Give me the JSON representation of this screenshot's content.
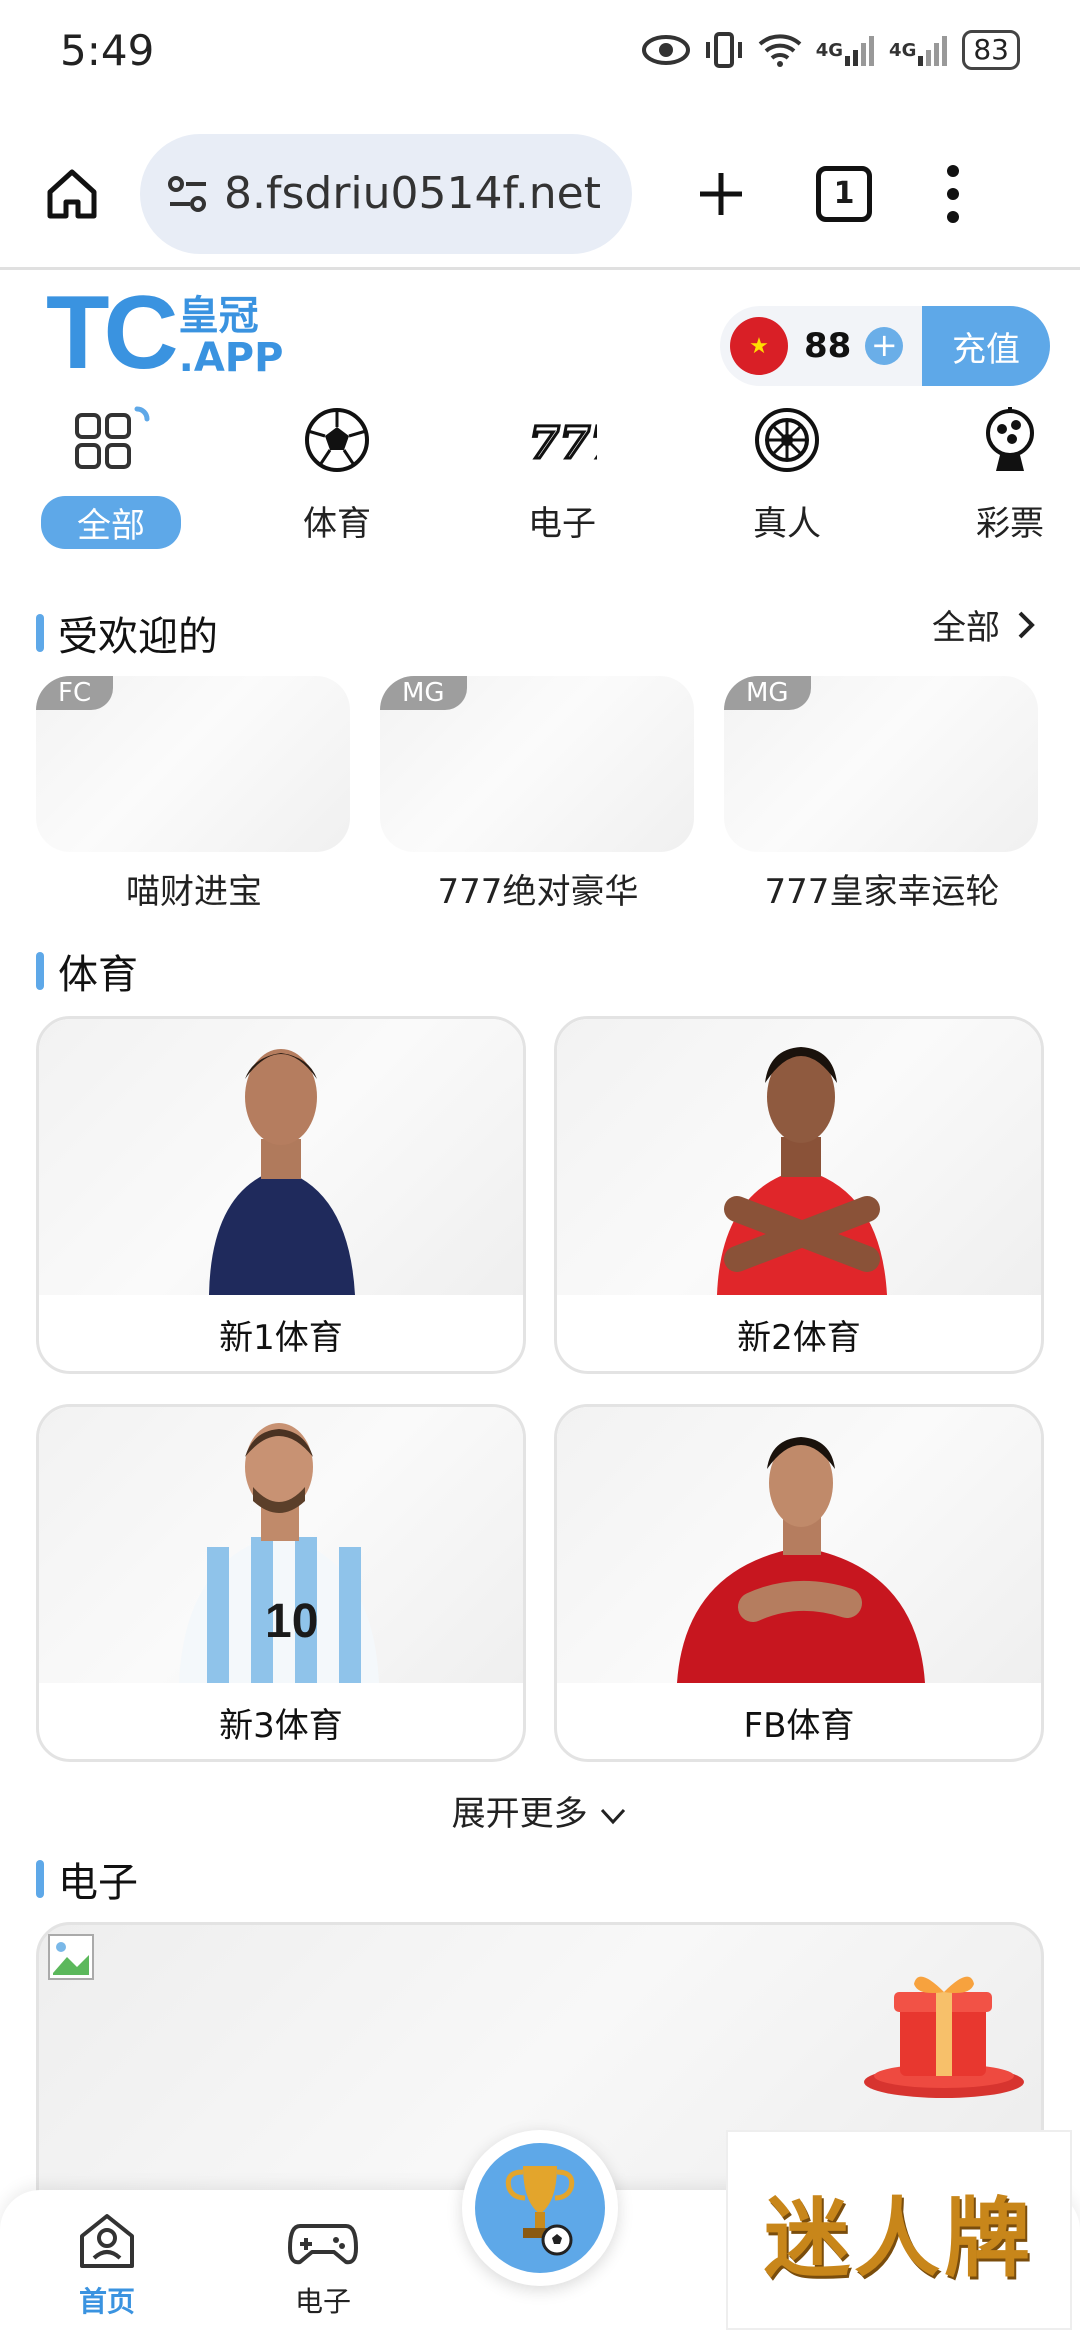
{
  "status_bar": {
    "time": "5:49",
    "battery": "83",
    "net1": "4G",
    "net2": "4G"
  },
  "browser": {
    "url": "8.fsdriu0514f.net",
    "tab_count": "1"
  },
  "header": {
    "logo_main": "TC",
    "logo_cn": "皇冠",
    "logo_app": ".APP",
    "balance": "88",
    "recharge_label": "充值"
  },
  "categories": [
    {
      "label": "全部",
      "icon": "grid-icon",
      "active": true
    },
    {
      "label": "体育",
      "icon": "soccer-ball-icon"
    },
    {
      "label": "电子",
      "icon": "slot-777-icon"
    },
    {
      "label": "真人",
      "icon": "roulette-icon"
    },
    {
      "label": "彩票",
      "icon": "lottery-ball-icon"
    }
  ],
  "popular": {
    "title": "受欢迎的",
    "see_all": "全部",
    "items": [
      {
        "tag": "FC",
        "label": "喵财进宝"
      },
      {
        "tag": "MG",
        "label": "777绝对豪华"
      },
      {
        "tag": "MG",
        "label": "777皇家幸运轮"
      }
    ]
  },
  "sports": {
    "title": "体育",
    "items": [
      {
        "label": "新1体育",
        "jersey": "#1f2a5c"
      },
      {
        "label": "新2体育",
        "jersey": "#e0262a"
      },
      {
        "label": "新3体育",
        "jersey": "#8fc3ea"
      },
      {
        "label": "FB体育",
        "jersey": "#c7161f"
      }
    ],
    "expand_label": "展开更多"
  },
  "electronic": {
    "title": "电子"
  },
  "bottom_nav": {
    "items": [
      {
        "label": "首页",
        "icon": "home-icon",
        "active": true
      },
      {
        "label": "电子",
        "icon": "gamepad-icon"
      }
    ]
  },
  "watermark": {
    "text": "迷人牌"
  },
  "colors": {
    "accent": "#5ea8e8",
    "logo": "#3a93e0"
  }
}
